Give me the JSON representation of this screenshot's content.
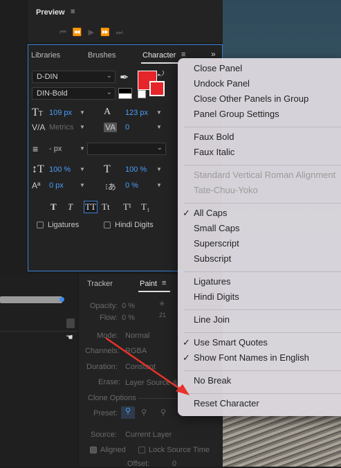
{
  "preview": {
    "title": "Preview"
  },
  "character_panel": {
    "tabs": [
      "Libraries",
      "Brushes",
      "Character"
    ],
    "font_family": "D-DIN",
    "font_style": "DIN-Bold",
    "font_size": "109 px",
    "leading": "123 px",
    "kerning": "Metrics",
    "tracking": "0",
    "stroke_width": "- px",
    "vertical_scale": "100 %",
    "horizontal_scale": "100 %",
    "baseline_shift": "0 px",
    "tsume": "0 %",
    "style_buttons": [
      "T",
      "T",
      "TT",
      "Tt",
      "T¹",
      "T₁"
    ],
    "ligatures_label": "Ligatures",
    "hindi_digits_label": "Hindi Digits",
    "fill_color": "#e5252a"
  },
  "paint_panel": {
    "tabs": [
      "Tracker",
      "Paint"
    ],
    "opacity_label": "Opacity:",
    "opacity_value": "0 %",
    "flow_label": "Flow:",
    "flow_value": "0 %",
    "brush_size": "21",
    "mode_label": "Mode:",
    "mode_value": "Normal",
    "channels_label": "Channels:",
    "channels_value": "RGBA",
    "duration_label": "Duration:",
    "duration_value": "Constant",
    "erase_label": "Erase:",
    "erase_value": "Layer Source &",
    "clone_options": "Clone Options",
    "preset_label": "Preset:",
    "source_label": "Source:",
    "source_value": "Current Layer",
    "aligned_label": "Aligned",
    "lock_source_label": "Lock Source Time",
    "offset_label": "Offset:",
    "offset_value": "0"
  },
  "context_menu": {
    "groups": [
      [
        {
          "label": "Close Panel"
        },
        {
          "label": "Undock Panel"
        },
        {
          "label": "Close Other Panels in Group"
        },
        {
          "label": "Panel Group Settings"
        }
      ],
      [
        {
          "label": "Faux Bold"
        },
        {
          "label": "Faux Italic"
        }
      ],
      [
        {
          "label": "Standard Vertical Roman Alignment",
          "disabled": true
        },
        {
          "label": "Tate-Chuu-Yoko",
          "disabled": true
        }
      ],
      [
        {
          "label": "All Caps",
          "checked": true
        },
        {
          "label": "Small Caps"
        },
        {
          "label": "Superscript"
        },
        {
          "label": "Subscript"
        }
      ],
      [
        {
          "label": "Ligatures"
        },
        {
          "label": "Hindi Digits"
        }
      ],
      [
        {
          "label": "Line Join"
        }
      ],
      [
        {
          "label": "Use Smart Quotes",
          "checked": true
        },
        {
          "label": "Show Font Names in English",
          "checked": true
        }
      ],
      [
        {
          "label": "No Break"
        }
      ],
      [
        {
          "label": "Reset Character"
        }
      ]
    ]
  },
  "annotation_color": "#e8322a"
}
